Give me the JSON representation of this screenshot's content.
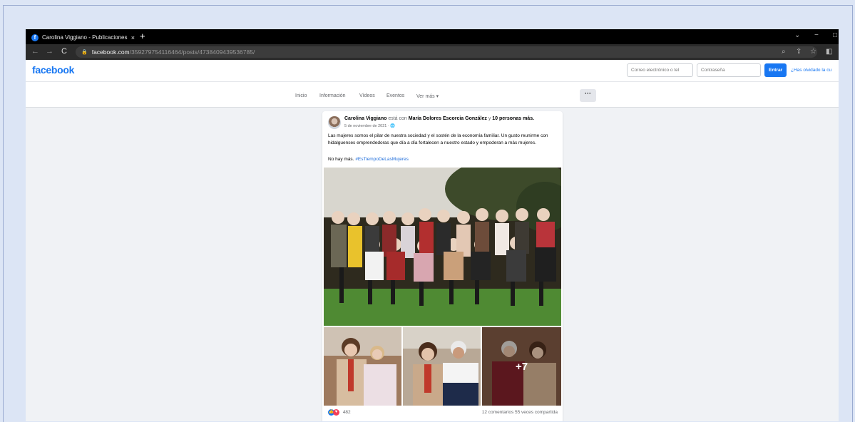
{
  "browser": {
    "tab_title": "Carolina Viggiano - Publicaciones",
    "tab_close": "×",
    "new_tab": "+",
    "url_host": "facebook.com",
    "url_path": "/359279754116464/posts/4738409439536785/"
  },
  "header": {
    "logo": "facebook",
    "email_placeholder": "Correo electrónico o tel",
    "password_placeholder": "Contraseña",
    "login_button": "Entrar",
    "forgot_link": "¿Has olvidado la cu"
  },
  "profile_nav": {
    "items": [
      "Inicio",
      "Información",
      "Vídeos",
      "Eventos",
      "Ver más ▾"
    ],
    "more": "···"
  },
  "post": {
    "author": "Carolina Viggiano",
    "with_text": "está con",
    "tagged": "María Dolores Escorcia González",
    "and_text": "y",
    "others": "10 personas más.",
    "date": "5 de noviembre de 2021 · 🌐",
    "body": "Las mujeres somos el pilar de nuestra sociedad y el sostén de la economía familiar. Un gusto reunirme con hidalguenses emprendedoras que día a día fortalecen a nuestro estado y empoderan a más mujeres.",
    "line2_prefix": "No hay más.",
    "hashtag": "#EsTiempoDeLasMujeres",
    "more_photos": "+7",
    "reaction_count": "482",
    "comments_shares": "12 comentarios  55 veces compartida"
  },
  "colors": {
    "brand": "#1877f2",
    "background": "#f0f2f5",
    "link": "#216fdb"
  }
}
